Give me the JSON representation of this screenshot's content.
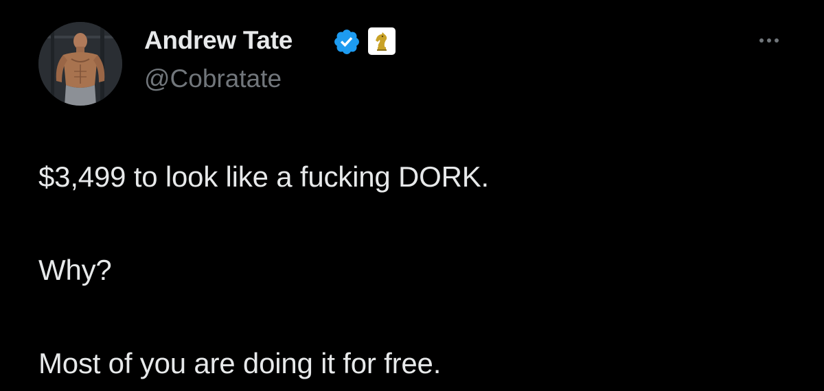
{
  "tweet": {
    "author": {
      "name": "Andrew Tate",
      "handle": "@Cobratate",
      "verified": true,
      "avatar_icon": "profile-photo",
      "affiliate_badge_icon": "chess-knight-icon"
    },
    "text_lines": [
      "$3,499 to look like a fucking DORK.",
      "Why?",
      "Most of you are doing it for free."
    ],
    "more_icon": "more-horizontal-icon"
  },
  "colors": {
    "background": "#000000",
    "primary_text": "#e7e9ea",
    "secondary_text": "#71767b",
    "verified_blue": "#1d9bf0",
    "affiliate_gold": "#c9a227"
  }
}
